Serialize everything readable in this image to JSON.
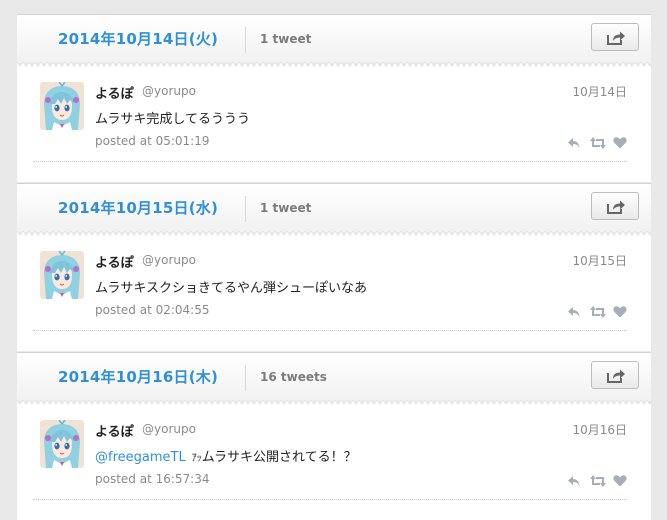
{
  "sections": [
    {
      "date": "2014年10月14日(火)",
      "count": "1 tweet",
      "tweet": {
        "username": "よるぽ",
        "handle": "@yorupo",
        "date": "10月14日",
        "mention": "",
        "prefix": "",
        "text": "ムラサキ完成してるううう",
        "posted": "posted at 05:01:19"
      }
    },
    {
      "date": "2014年10月15日(水)",
      "count": "1 tweet",
      "tweet": {
        "username": "よるぽ",
        "handle": "@yorupo",
        "date": "10月15日",
        "mention": "",
        "prefix": "",
        "text": "ムラサキスクショきてるやん弾シューぽいなあ",
        "posted": "posted at 02:04:55"
      }
    },
    {
      "date": "2014年10月16日(木)",
      "count": "16 tweets",
      "tweet": {
        "username": "よるぽ",
        "handle": "@yorupo",
        "date": "10月16日",
        "mention": "@freegameTL",
        "prefix": "ｱｯ",
        "text": "ムラサキ公開されてる！？",
        "posted": "posted at 16:57:34"
      }
    }
  ],
  "icons": {
    "share": "share-icon",
    "reply": "reply-icon",
    "retweet": "retweet-icon",
    "favorite": "heart-icon"
  },
  "colors": {
    "accent": "#2f8fd8",
    "background": "#e9e9e9"
  }
}
